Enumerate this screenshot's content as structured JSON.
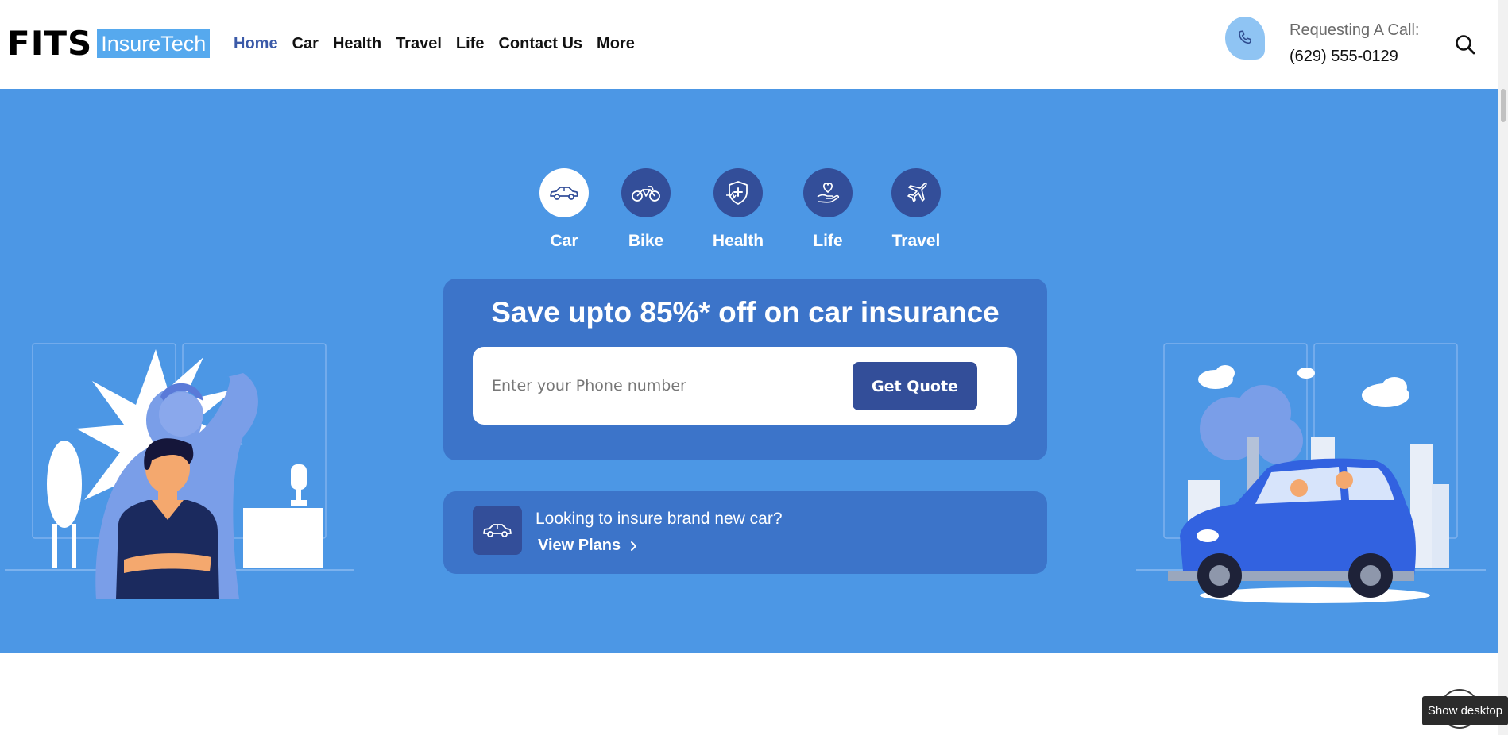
{
  "header": {
    "logo": {
      "brand": "FITS",
      "sub": "InsureTech"
    },
    "nav": [
      {
        "label": "Home",
        "active": true
      },
      {
        "label": "Car"
      },
      {
        "label": "Health"
      },
      {
        "label": "Travel"
      },
      {
        "label": "Life"
      },
      {
        "label": "Contact Us"
      },
      {
        "label": "More"
      }
    ],
    "call": {
      "label": "Requesting A Call:",
      "phone": "(629) 555-0129",
      "icon": "phone-icon"
    },
    "search_icon": "search-icon"
  },
  "hero": {
    "categories": [
      {
        "label": "Car",
        "icon": "car-icon",
        "active": true
      },
      {
        "label": "Bike",
        "icon": "bike-icon"
      },
      {
        "label": "Health",
        "icon": "health-shield-icon"
      },
      {
        "label": "Life",
        "icon": "heart-hand-icon"
      },
      {
        "label": "Travel",
        "icon": "airplane-icon"
      }
    ],
    "quote": {
      "title": "Save upto 85%* off on car insurance",
      "placeholder": "Enter your Phone number",
      "button": "Get Quote"
    },
    "plans": {
      "question": "Looking to insure brand new car?",
      "link": "View Plans",
      "icon": "car-icon"
    }
  },
  "tooltip": {
    "text": "Show desktop"
  },
  "colors": {
    "hero_bg": "#4c97e5",
    "card_bg": "#3c74c9",
    "button_bg": "#334e99",
    "logo_box": "#56a9ee",
    "nav_active": "#3b5aa8"
  }
}
